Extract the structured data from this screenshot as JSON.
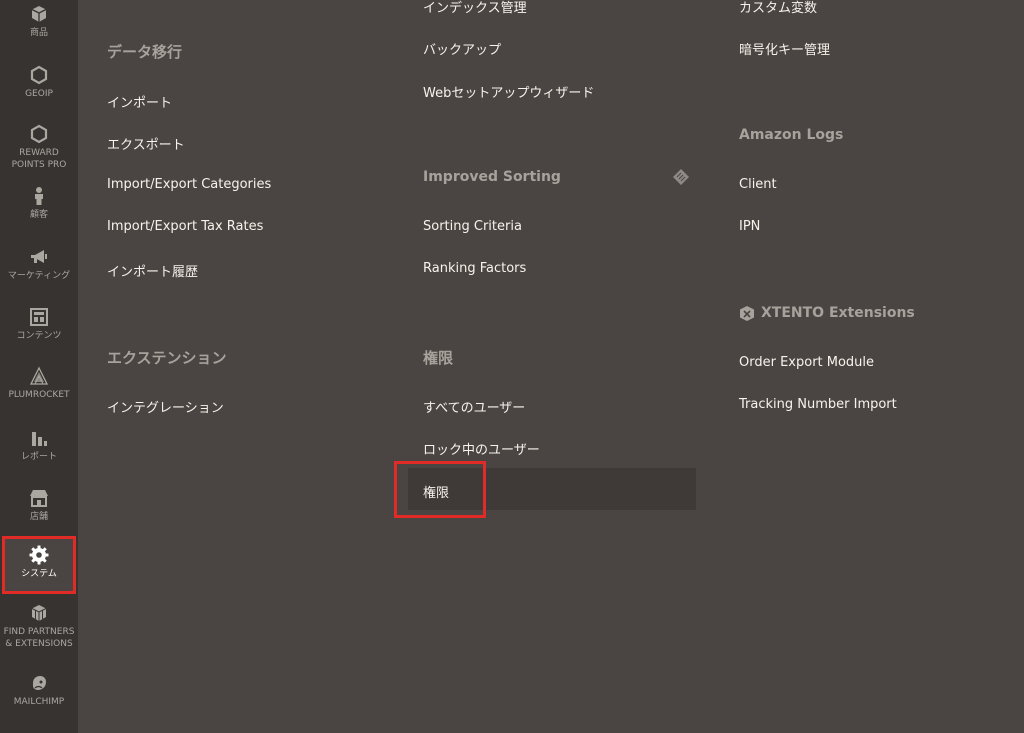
{
  "sidebar": {
    "items": [
      {
        "label": "商品",
        "icon": "box-icon"
      },
      {
        "label": "GEOIP",
        "icon": "hexagon-icon"
      },
      {
        "label": "REWARD\nPOINTS PRO",
        "icon": "hexagon-icon"
      },
      {
        "label": "顧客",
        "icon": "person-icon"
      },
      {
        "label": "マーケティング",
        "icon": "megaphone-icon"
      },
      {
        "label": "コンテンツ",
        "icon": "layout-icon"
      },
      {
        "label": "PLUMROCKET",
        "icon": "plumrocket-logo-icon"
      },
      {
        "label": "レポート",
        "icon": "bar-chart-icon"
      },
      {
        "label": "店舗",
        "icon": "store-icon"
      },
      {
        "label": "システム",
        "icon": "gear-icon",
        "active": true
      },
      {
        "label": "FIND PARTNERS\n& EXTENSIONS",
        "icon": "blocks-icon"
      },
      {
        "label": "MAILCHIMP",
        "icon": "mailchimp-icon"
      }
    ]
  },
  "column1": {
    "heading": "データ移行",
    "links": [
      "インポート",
      "エクスポート",
      "Import/Export Categories",
      "Import/Export Tax Rates",
      "インポート履歴"
    ],
    "heading2": "エクステンション",
    "links2": [
      "インテグレーション"
    ]
  },
  "column2": {
    "top_links": [
      "インデックス管理",
      "バックアップ",
      "Webセットアップウィザード"
    ],
    "heading": "Improved Sorting",
    "links": [
      "Sorting Criteria",
      "Ranking Factors"
    ],
    "heading2": "権限",
    "links2": [
      "すべてのユーザー",
      "ロック中のユーザー",
      "権限"
    ]
  },
  "column3": {
    "top_links": [
      "カスタム変数",
      "暗号化キー管理"
    ],
    "heading": "Amazon Logs",
    "links": [
      "Client",
      "IPN"
    ],
    "heading2": "XTENTO Extensions",
    "links2": [
      "Order Export Module",
      "Tracking Number Import"
    ]
  },
  "colors": {
    "sidebar_bg": "#373330",
    "panel_bg": "#4a4542",
    "highlight": "#e02b27",
    "link_text": "#f7f3eb",
    "heading_text": "#a8a29c"
  }
}
